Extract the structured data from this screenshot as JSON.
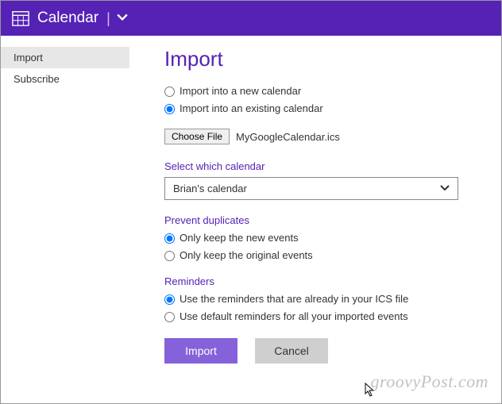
{
  "header": {
    "title": "Calendar"
  },
  "sidebar": {
    "items": [
      {
        "label": "Import"
      },
      {
        "label": "Subscribe"
      }
    ]
  },
  "page": {
    "title": "Import"
  },
  "importMode": {
    "options": [
      {
        "label": "Import into a new calendar",
        "checked": false
      },
      {
        "label": "Import into an existing calendar",
        "checked": true
      }
    ]
  },
  "file": {
    "chooseLabel": "Choose File",
    "fileName": "MyGoogleCalendar.ics"
  },
  "selectCalendar": {
    "title": "Select which calendar",
    "value": "Brian's calendar"
  },
  "duplicates": {
    "title": "Prevent duplicates",
    "options": [
      {
        "label": "Only keep the new events",
        "checked": true
      },
      {
        "label": "Only keep the original events",
        "checked": false
      }
    ]
  },
  "reminders": {
    "title": "Reminders",
    "options": [
      {
        "label": "Use the reminders that are already in your ICS file",
        "checked": true
      },
      {
        "label": "Use default reminders for all your imported events",
        "checked": false
      }
    ]
  },
  "buttons": {
    "import": "Import",
    "cancel": "Cancel"
  },
  "watermark": "groovyPost.com"
}
